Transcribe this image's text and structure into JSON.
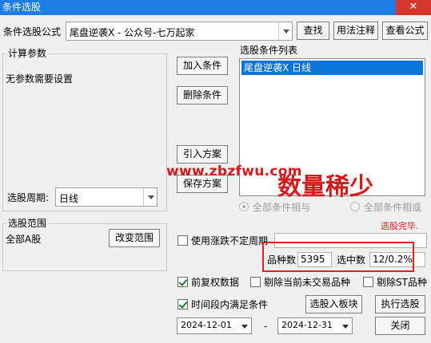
{
  "window": {
    "title": "条件选股",
    "close_glyph": "✕"
  },
  "formula": {
    "label": "条件选股公式",
    "value": "尾盘逆袭X  -  公众号-七万起家",
    "buttons": {
      "find": "查找",
      "usage": "用法注释",
      "view": "查看公式"
    }
  },
  "params": {
    "title": "计算参数",
    "text": "无参数需要设置",
    "period_label": "选股周期:",
    "period_value": "日线"
  },
  "actions": {
    "add": "加入条件",
    "remove": "删除条件",
    "import": "引入方案",
    "save": "保存方案"
  },
  "condition_list": {
    "title": "选股条件列表",
    "items": [
      "尾盘逆袭X  日线"
    ]
  },
  "logic": {
    "and_label": "全部条件相与",
    "or_label": "全部条件相或",
    "selected": "and"
  },
  "watermark": {
    "site": "www.zbzfwu.com",
    "banner": "数量稀少"
  },
  "status": {
    "done": "选股完毕.",
    "unstable_period": "使用涨跌不定周期",
    "count_label": "品种数",
    "count_value": "5395",
    "selected_label": "选中数",
    "selected_value": "12/0.2%"
  },
  "scope": {
    "title": "选股范围",
    "text": "全部A股",
    "change_button": "改变范围"
  },
  "options": {
    "adjust": "前复权数据",
    "exclude_untraded": "剔除当前未交易品种",
    "exclude_st": "剔除ST品种",
    "time_range": "时间段内满足条件",
    "to_block_button": "选股入板块",
    "run_button": "执行选股"
  },
  "dates": {
    "start": "2024-12-01",
    "separator": "-",
    "end": "2024-12-31",
    "close_button": "关闭"
  },
  "colors": {
    "titlebar": "#1e7ee6",
    "selection": "#0a74d8",
    "highlight": "#e0221b",
    "watermark": "#d41a1a"
  }
}
